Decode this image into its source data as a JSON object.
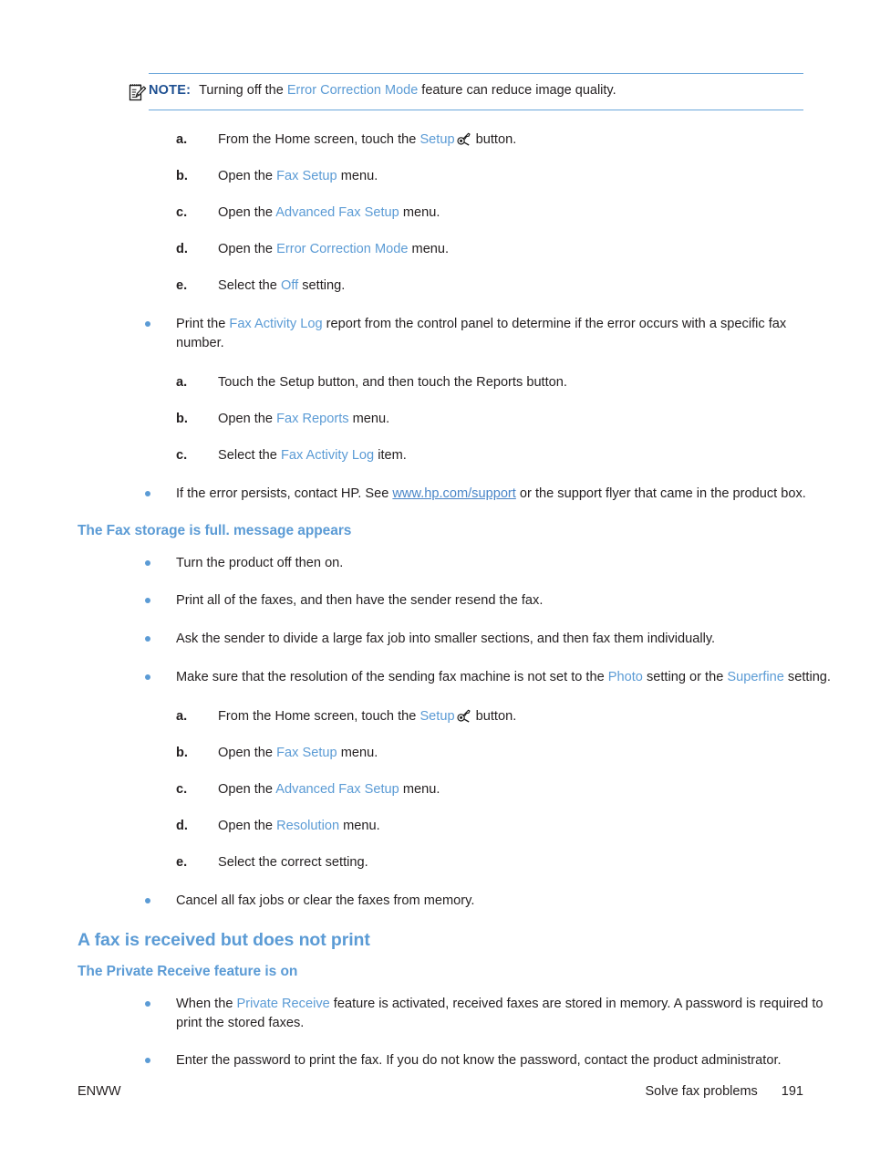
{
  "note": {
    "icon": "note-pad-pencil-icon",
    "label": "NOTE:",
    "text_before": "Turning off the ",
    "emphasis": "Error Correction Mode",
    "text_after": " feature can reduce image quality."
  },
  "steps_ecm": [
    {
      "marker": "a.",
      "pre": "From the Home screen, touch the ",
      "em": "Setup",
      "mid": "",
      "icon": "setup-wrench-icon",
      "post": " button."
    },
    {
      "marker": "b.",
      "pre": "Open the ",
      "em": "Fax Setup",
      "post": " menu."
    },
    {
      "marker": "c.",
      "pre": "Open the ",
      "em": "Advanced Fax Setup",
      "post": " menu."
    },
    {
      "marker": "d.",
      "pre": "Open the ",
      "em": "Error Correction Mode",
      "post": " menu."
    },
    {
      "marker": "e.",
      "pre": "Select the ",
      "em": "Off",
      "post": " setting."
    }
  ],
  "bullet_fax_activity": {
    "pre": "Print the ",
    "em": "Fax Activity Log",
    "post": " report from the control panel to determine if the error occurs with a specific fax number."
  },
  "steps_report": [
    {
      "marker": "a.",
      "pre": "Touch the Setup button, and then touch the Reports button.",
      "em": "",
      "post": ""
    },
    {
      "marker": "b.",
      "pre": "Open the ",
      "em": "Fax Reports",
      "post": " menu."
    },
    {
      "marker": "c.",
      "pre": "Select the ",
      "em": "Fax Activity Log",
      "post": " item."
    }
  ],
  "bullet_contact_hp": {
    "pre": "If the error persists, contact HP. See ",
    "link": "www.hp.com/support",
    "post": " or the support flyer that came in the product box."
  },
  "section_storage": {
    "heading": "The Fax storage is full. message appears",
    "bullets": [
      "Turn the product off then on.",
      "Print all of the faxes, and then have the sender resend the fax.",
      "Ask the sender to divide a large fax job into smaller sections, and then fax them individually."
    ],
    "bullet_resolution": {
      "pre": "Make sure that the resolution of the sending fax machine is not set to the ",
      "em1": "Photo",
      "mid": " setting or the ",
      "em2": "Superfine",
      "post": " setting."
    },
    "steps": [
      {
        "marker": "a.",
        "pre": "From the Home screen, touch the ",
        "em": "Setup",
        "icon": "setup-wrench-icon",
        "post": " button."
      },
      {
        "marker": "b.",
        "pre": "Open the ",
        "em": "Fax Setup",
        "post": " menu."
      },
      {
        "marker": "c.",
        "pre": "Open the ",
        "em": "Advanced Fax Setup",
        "post": " menu."
      },
      {
        "marker": "d.",
        "pre": "Open the ",
        "em": "Resolution",
        "post": " menu."
      },
      {
        "marker": "e.",
        "pre": "Select the correct setting.",
        "em": "",
        "post": ""
      }
    ],
    "bullet_cancel": "Cancel all fax jobs or clear the faxes from memory."
  },
  "section_noprint": {
    "heading": "A fax is received but does not print",
    "subheading": "The Private Receive feature is on",
    "bullet_private": {
      "pre": "When the ",
      "em": "Private Receive",
      "post": " feature is activated, received faxes are stored in memory. A password is required to print the stored faxes."
    },
    "bullet_password": "Enter the password to print the fax. If you do not know the password, contact the product administrator."
  },
  "footer": {
    "left": "ENWW",
    "chapter": "Solve fax problems",
    "page": "191"
  },
  "colors": {
    "accent_blue": "#5b9bd5",
    "note_label_blue": "#1d4f91",
    "link_blue": "#4a86c8",
    "text": "#231f20"
  }
}
